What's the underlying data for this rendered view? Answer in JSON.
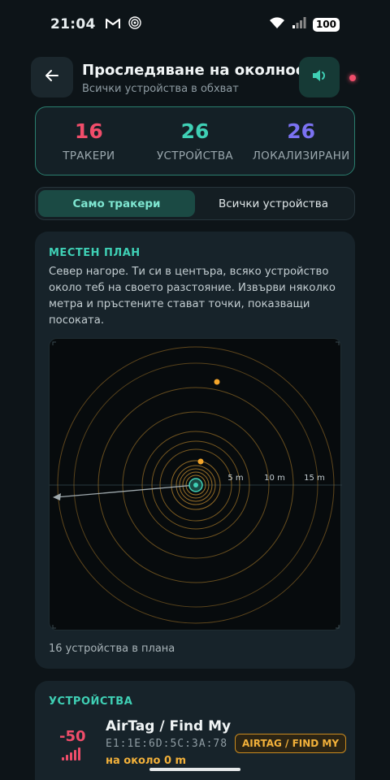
{
  "status_bar": {
    "time": "21:04",
    "battery": "100",
    "icons": [
      "gmail-icon",
      "hotspot-icon",
      "wifi-icon",
      "cell-signal-icon"
    ]
  },
  "header": {
    "title": "Проследяване на околността",
    "subtitle": "Всички устройства в обхват",
    "back_icon": "arrow-left-icon",
    "sound_icon": "speaker-icon"
  },
  "stats": [
    {
      "value": "16",
      "label": "ТРАКЕРИ",
      "color": "#f04d6a"
    },
    {
      "value": "26",
      "label": "УСТРОЙСТВА",
      "color": "#3fd0b5"
    },
    {
      "value": "26",
      "label": "ЛОКАЛИЗИРАНИ",
      "color": "#7b72f2"
    }
  ],
  "toggle": {
    "options": [
      "Само тракери",
      "Всички устройства"
    ],
    "selected": "Само тракери"
  },
  "map": {
    "section_title": "МЕСТЕН ПЛАН",
    "description": "Север нагоре. Ти си в центъра, всяко устройство около теб на своето разстояние. Извърви няколко метра и пръстените стават точки, показващи посоката.",
    "scale_labels": [
      "5 m",
      "10 m",
      "15 m"
    ],
    "footer": "16 устройства в плана",
    "colors": {
      "ring": "#a7792a",
      "accent": "#3fd0b5",
      "dot": "#f3a52b"
    }
  },
  "devices": {
    "section_title": "УСТРОЙСТВА",
    "items": [
      {
        "rssi": "-50",
        "name": "AirTag / Find My",
        "mac": "E1:1E:6D:5C:3A:78",
        "distance": "на около 0 m",
        "badge": "AIRTAG / FIND MY"
      }
    ]
  }
}
